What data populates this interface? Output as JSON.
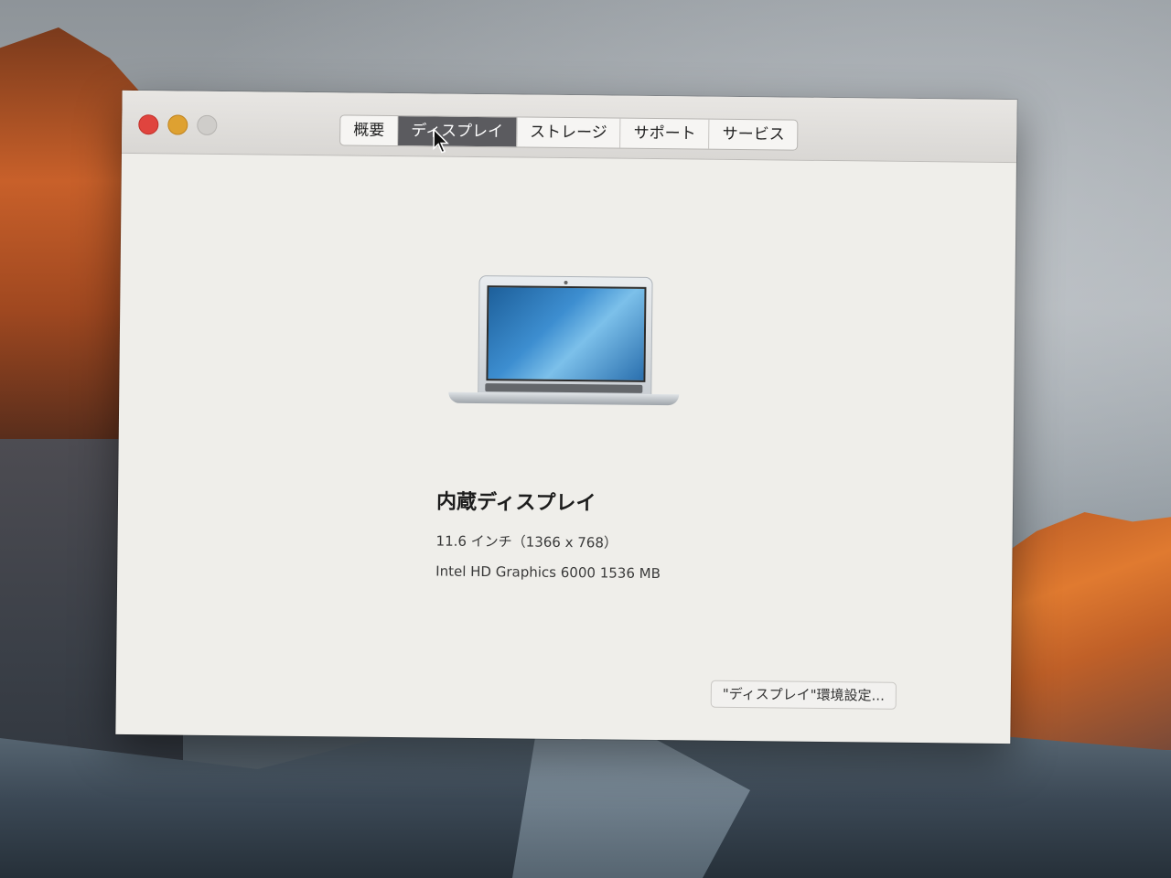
{
  "window": {
    "tabs": [
      {
        "label": "概要"
      },
      {
        "label": "ディスプレイ"
      },
      {
        "label": "ストレージ"
      },
      {
        "label": "サポート"
      },
      {
        "label": "サービス"
      }
    ],
    "active_tab": "ディスプレイ"
  },
  "display": {
    "name": "内蔵ディスプレイ",
    "size": "11.6 インチ（1366 x 768）",
    "graphics": "Intel HD Graphics 6000 1536 MB"
  },
  "prefs_button": {
    "label": "\"ディスプレイ\"環境設定..."
  },
  "colors": {
    "close": "#e0443e",
    "minimize": "#dea131",
    "zoom_disabled": "#cfcdca",
    "active_tab_bg": "#5b5b5f"
  },
  "icons": [
    "laptop-icon",
    "mouse-pointer-icon"
  ]
}
